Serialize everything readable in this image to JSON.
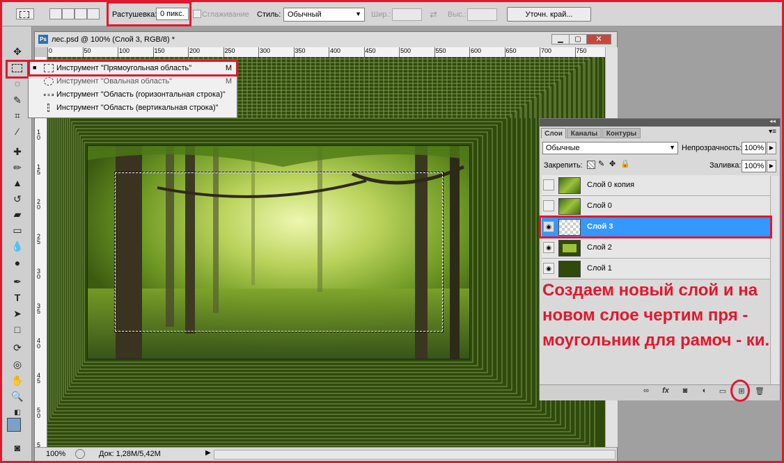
{
  "options_bar": {
    "feather_label": "Растушевка:",
    "feather_value": "0 пикс.",
    "antialias_label": "Сглаживание",
    "style_label": "Стиль:",
    "style_value": "Обычный",
    "width_label": "Шир.:",
    "height_label": "Выс.:",
    "refine_edge_button": "Уточн. край..."
  },
  "document": {
    "title": "лес.psd @ 100% (Слой 3, RGB/8) *",
    "ps_badge": "Ps",
    "zoom": "100%",
    "doc_info": "Док: 1,28M/5,42M",
    "ruler_labels": [
      "0",
      "50",
      "100",
      "150",
      "200",
      "250",
      "300",
      "350",
      "400",
      "450",
      "500",
      "550",
      "600",
      "650",
      "700",
      "750"
    ],
    "vruler_labels": [
      "0",
      "5",
      "1 0",
      "1 5",
      "2 0",
      "2 5",
      "3 0",
      "3 5",
      "4 0",
      "4 5",
      "5 0",
      "5 5"
    ]
  },
  "tool_flyout": {
    "items": [
      {
        "label": "Инструмент \"Прямоугольная область\"",
        "key": "M",
        "active": true
      },
      {
        "label": "Инструмент \"Овальная область\"",
        "key": "M",
        "active": false
      },
      {
        "label": "Инструмент \"Область (горизонтальная строка)\"",
        "key": "",
        "active": false
      },
      {
        "label": "Инструмент \"Область (вертикальная строка)\"",
        "key": "",
        "active": false
      }
    ]
  },
  "layers_panel": {
    "tabs": [
      "Слои",
      "Каналы",
      "Контуры"
    ],
    "blend_mode": "Обычные",
    "opacity_label": "Непрозрачность:",
    "opacity_value": "100%",
    "lock_label": "Закрепить:",
    "fill_label": "Заливка:",
    "fill_value": "100%",
    "layers": [
      {
        "name": "Слой 0 копия",
        "visible": false,
        "selected": false
      },
      {
        "name": "Слой 0",
        "visible": false,
        "selected": false
      },
      {
        "name": "Слой 3",
        "visible": true,
        "selected": true
      },
      {
        "name": "Слой 2",
        "visible": true,
        "selected": false
      },
      {
        "name": "Слой 1",
        "visible": true,
        "selected": false
      }
    ]
  },
  "annotation": {
    "text": "Создаем новый слой и на новом слое чертим пря - моугольник для рамоч - ки."
  },
  "colors": {
    "highlight_red": "#e0182d",
    "selected_layer": "#3399ff",
    "canvas_green": "#2f4a0b"
  }
}
